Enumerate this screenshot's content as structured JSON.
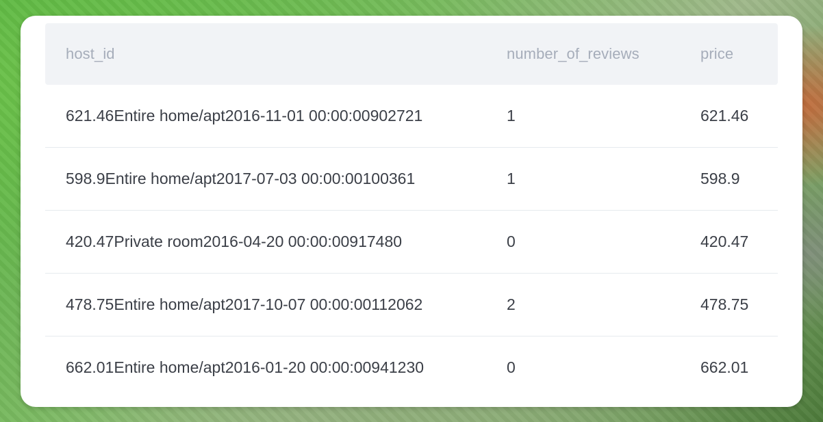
{
  "table": {
    "columns": [
      "host_id",
      "number_of_reviews",
      "price"
    ],
    "rows": [
      {
        "host_id": "621.46Entire home/apt2016-11-01 00:00:00902721",
        "number_of_reviews": "1",
        "price": "621.46"
      },
      {
        "host_id": "598.9Entire home/apt2017-07-03 00:00:00100361",
        "number_of_reviews": "1",
        "price": "598.9"
      },
      {
        "host_id": "420.47Private room2016-04-20 00:00:00917480",
        "number_of_reviews": "0",
        "price": "420.47"
      },
      {
        "host_id": "478.75Entire home/apt2017-10-07 00:00:00112062",
        "number_of_reviews": "2",
        "price": "478.75"
      },
      {
        "host_id": "662.01Entire home/apt2016-01-20 00:00:00941230",
        "number_of_reviews": "0",
        "price": "662.01"
      }
    ]
  },
  "colors": {
    "header_bg": "#f1f3f6",
    "header_text": "#a6adba",
    "cell_text": "#3b3f47",
    "divider": "#e6eaee",
    "card_bg": "#ffffff"
  }
}
